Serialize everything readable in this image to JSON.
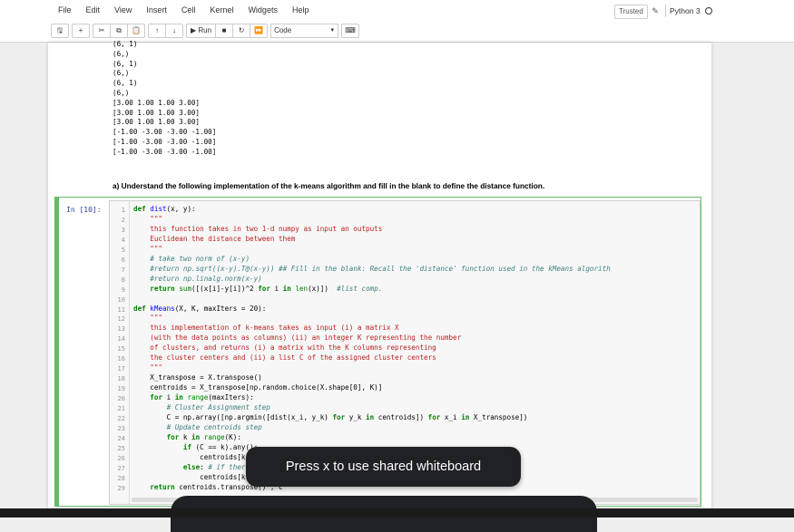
{
  "menu": [
    "File",
    "Edit",
    "View",
    "Insert",
    "Cell",
    "Kernel",
    "Widgets",
    "Help"
  ],
  "status": {
    "trusted": "Trusted",
    "kernel": "Python 3"
  },
  "toolbar": {
    "run_label": "Run",
    "cell_type": "Code"
  },
  "output_lines": [
    "(6, 1)",
    "(6,)",
    "(6, 1)",
    "(6,)",
    "(6, 1)",
    "(6,)",
    "[3.00 1.00 1.00 3.00]",
    "[3.00 1.00 1.00 3.00]",
    "[3.00 1.00 1.00 3.00]",
    "[-1.00 -3.00 -3.00 -1.00]",
    "[-1.00 -3.00 -3.00 -1.00]",
    "[-1.00 -3.00 -3.00 -1.00]"
  ],
  "markdown": "a) Understand the following implementation of the k-means algorithm and fill in the blank to define the distance function.",
  "cell_prompt": "In [10]:",
  "code_lines": [
    "def dist(x, y):",
    "    \"\"\"",
    "    this function takes in two 1-d numpy as input an outputs",
    "    Euclidean the distance between them",
    "    \"\"\"",
    "    # take two norm of (x-y)",
    "    #return np.sqrt((x-y).T@(x-y)) ## Fill in the blank: Recall the 'distance' function used in the kMeans algorith",
    "    #return np.linalg.norm(x-y)",
    "    return sum([(x[i]-y[i])^2 for i in len(x)])  #list comp.",
    "",
    "def kMeans(X, K, maxIters = 20):",
    "    \"\"\"",
    "    this implementation of k-means takes as input (i) a matrix X",
    "    (with the data points as columns) (ii) an integer K representing the number",
    "    of clusters, and returns (i) a matrix with the K columns representing",
    "    the cluster centers and (ii) a list C of the assigned cluster centers",
    "    \"\"\"",
    "    X_transpose = X.transpose()",
    "    centroids = X_transpose[np.random.choice(X.shape[0], K)]",
    "    for i in range(maxIters):",
    "        # Cluster Assignment step",
    "        C = np.array([np.argmin([dist(x_i, y_k) for y_k in centroids]) for x_i in X_transpose])",
    "        # Update centroids step",
    "        for k in range(K):",
    "            if (C == k).any():",
    "                centroids[k] = X_transpose[C == k].mean(axis = 0)",
    "            else: # if there are no data points assigned to this certain centroid",
    "                centroids[k] = X_transpose[np.random.choice(len(X_transpose))]",
    "    return centroids.transpose() , C"
  ],
  "toast": "Press x to use shared whiteboard"
}
